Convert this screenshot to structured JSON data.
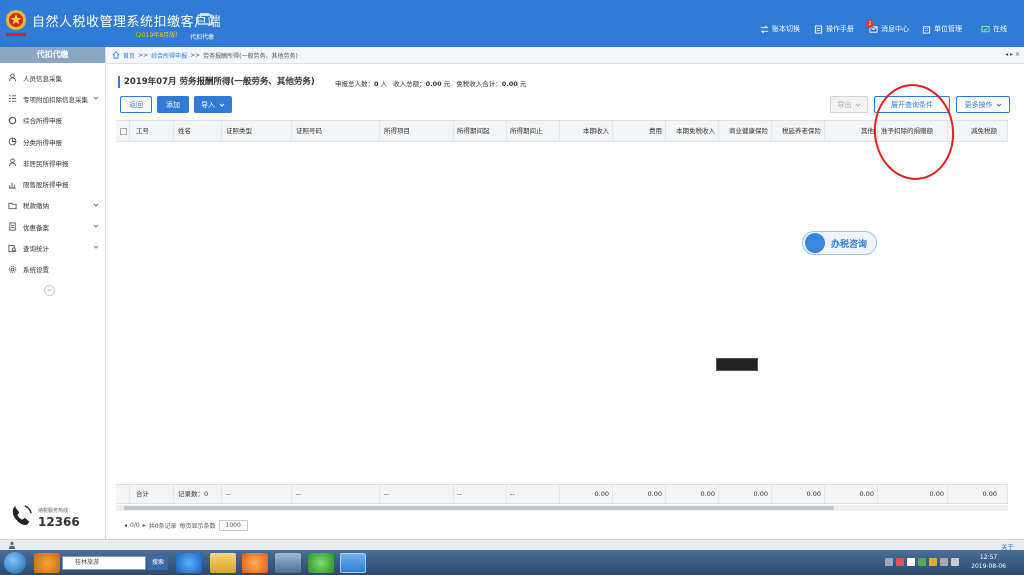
{
  "header": {
    "app_title": "自然人税收管理系统扣缴客户端",
    "version": "（2019年8月版）",
    "agent_label": "代扣代缴",
    "nav": [
      {
        "label": "账本切换",
        "icon": "swap-icon"
      },
      {
        "label": "操作手册",
        "icon": "manual-icon"
      },
      {
        "label": "消息中心",
        "icon": "message-icon",
        "badge": "2"
      },
      {
        "label": "单位管理",
        "icon": "building-icon"
      },
      {
        "label": "在线",
        "icon": "online-icon"
      }
    ]
  },
  "sidebar": {
    "title": "代扣代缴",
    "items": [
      {
        "label": "人员信息采集",
        "icon": "person-icon"
      },
      {
        "label": "专项附加扣除信息采集",
        "icon": "list-icon"
      },
      {
        "label": "综合所得申报",
        "icon": "ring-icon"
      },
      {
        "label": "分类所得申报",
        "icon": "pie-icon"
      },
      {
        "label": "非居民所得申报",
        "icon": "person-icon"
      },
      {
        "label": "限售股所得申报",
        "icon": "bar-icon"
      },
      {
        "label": "税款缴纳",
        "icon": "folder-icon"
      },
      {
        "label": "优惠备案",
        "icon": "doc-icon"
      },
      {
        "label": "查询统计",
        "icon": "query-icon"
      },
      {
        "label": "系统设置",
        "icon": "gear-icon"
      }
    ],
    "hotline_label": "纳税服务热线",
    "hotline_number": "12366"
  },
  "breadcrumb": {
    "home": "首页",
    "level1": "综合所得申报",
    "level2": "劳务报酬所得(一般劳务、其他劳务)",
    "sep": ">>"
  },
  "main": {
    "title": "2019年07月 劳务报酬所得(一般劳务、其他劳务)",
    "stats": {
      "count_label": "申报总人数：",
      "count": "0",
      "count_unit": "人",
      "income_label": "收入总额：",
      "income": "0.00",
      "income_unit": "元",
      "tax_free_label": "免税收入合计：",
      "tax_free": "0.00",
      "tax_free_unit": "元"
    },
    "buttons": {
      "back": "返回",
      "add": "添加",
      "import": "导入",
      "export": "导出",
      "expand": "展开查询条件",
      "more": "更多操作"
    },
    "columns": [
      "工号",
      "姓名",
      "证照类型",
      "证照号码",
      "所得项目",
      "所得期间起",
      "所得期间止",
      "本期收入",
      "费用",
      "本期免税收入",
      "商业健康保险",
      "税延养老保险",
      "其他",
      "准予扣除的捐赠额",
      "减免税额"
    ],
    "totals": {
      "label": "合计",
      "records": "记录数：0",
      "dashes": [
        "--",
        "--",
        "--",
        "--",
        "--"
      ],
      "values": [
        "0.00",
        "0.00",
        "0.00",
        "0.00",
        "0.00",
        "0.00",
        "0.00",
        "0.00"
      ]
    },
    "pager": {
      "page": "0/0",
      "summary": "共0条记录",
      "size_label": "每页显示条数",
      "size": "1000"
    },
    "consult_label": "办税咨询"
  },
  "statusbar": {
    "right": "关于"
  },
  "taskbar": {
    "search_text": "桂林旅游",
    "search_btn": "搜索",
    "time": "12:57",
    "date": "2019-08-06"
  }
}
